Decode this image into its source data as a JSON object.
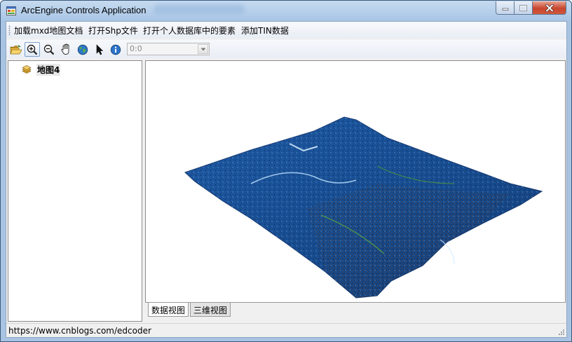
{
  "window": {
    "title": "ArcEngine Controls Application"
  },
  "menu": {
    "items": [
      "加载mxd地图文档",
      "打开Shp文件",
      "打开个人数据库中的要素",
      "添加TIN数据"
    ]
  },
  "toolbar": {
    "tools": [
      "open-icon",
      "zoom-in-icon",
      "zoom-out-icon",
      "pan-hand-icon",
      "full-extent-globe-icon",
      "select-arrow-icon",
      "identify-icon"
    ],
    "scale_value": "0:0"
  },
  "toc": {
    "map_name": "地图4"
  },
  "view_tabs": [
    "数据视图",
    "三维视图"
  ],
  "status": {
    "text": "https://www.cnblogs.com/edcoder"
  },
  "colors": {
    "terrain_low": "#173f7f",
    "terrain_mid": "#2f6fb3",
    "terrain_high": "#6b3a1f",
    "accent_green": "#4c9a3a"
  }
}
